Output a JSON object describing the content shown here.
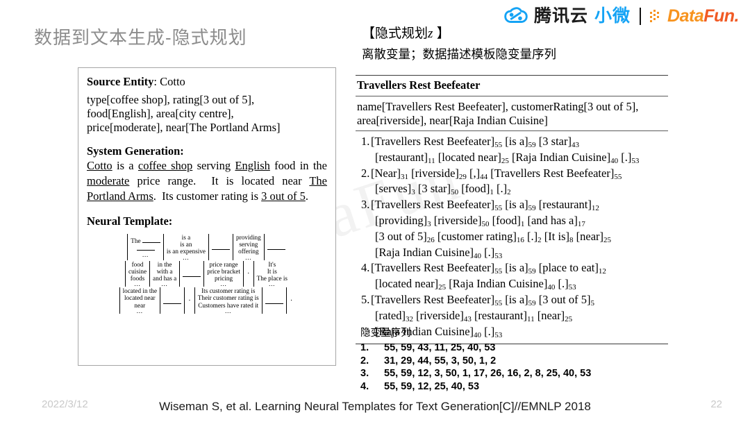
{
  "slide": {
    "title": "数据到文本生成-隐式规划",
    "page_number": "22",
    "date": "2022/3/12",
    "citation": "Wiseman S, et al. Learning Neural Templates for Text Generation[C]//EMNLP 2018",
    "watermark": "DataFun"
  },
  "logo": {
    "tencent_dark": "腾讯云",
    "tencent_blue": "小微",
    "datafun_part1": "Data",
    "datafun_part2": "Fun.",
    "blue": "#14a3f5",
    "orange": "#f7931e",
    "orange2": "#f15a24"
  },
  "left_figure": {
    "source_entity_label": "Source Entity",
    "source_entity_value": ": Cotto",
    "source_lines": [
      "type[coffee shop], rating[3 out of 5],",
      "food[English], area[city centre],",
      "price[moderate], near[The Portland Arms]"
    ],
    "system_generation_label": "System Generation:",
    "system_generation_text": "Cotto is a coffee shop serving English food in the moderate price range.  It is located near The Portland Arms.  Its customer rating is 3 out of 5.",
    "neural_template_label": "Neural Template:",
    "template_rows": [
      {
        "cells": [
          {
            "lines": [
              "The ____",
              "____"
            ],
            "dots": true
          },
          {
            "lines": [
              "is a",
              "is an",
              "is an expensive"
            ],
            "dots": true
          },
          {
            "lines": [
              "____"
            ],
            "dots": false
          },
          {
            "lines": [
              "providing",
              "serving",
              "offering"
            ],
            "dots": true
          },
          {
            "lines": [
              "____"
            ],
            "dots": false
          }
        ]
      },
      {
        "cells": [
          {
            "lines": [
              "food",
              "cuisine",
              "foods"
            ],
            "dots": true
          },
          {
            "lines": [
              "in the",
              "with a",
              "and has a"
            ],
            "dots": true
          },
          {
            "lines": [
              "____"
            ],
            "dots": false
          },
          {
            "lines": [
              "price range",
              "price bracket",
              "pricing"
            ],
            "dots": true
          },
          {
            "lines": [
              "."
            ],
            "dots": false
          },
          {
            "lines": [
              "It's",
              "It is",
              "The place is"
            ],
            "dots": true
          }
        ]
      },
      {
        "cells": [
          {
            "lines": [
              "located in the",
              "located near",
              "near"
            ],
            "dots": true
          },
          {
            "lines": [
              "____"
            ],
            "dots": false
          },
          {
            "lines": [
              "."
            ],
            "dots": false
          },
          {
            "lines": [
              "Its customer rating is",
              "Their customer rating is",
              "Customers have rated it"
            ],
            "dots": true
          },
          {
            "lines": [
              "____"
            ],
            "dots": false
          },
          {
            "lines": [
              "."
            ],
            "dots": false
          }
        ]
      }
    ]
  },
  "right_header": {
    "bracket_title": "【隐式规划z 】",
    "subtitle": "离散变量；数据描述模板隐变量序列"
  },
  "right_panel": {
    "title": "Travellers Rest Beefeater",
    "meta_lines": [
      "name[Travellers Rest Beefeater], customerRating[3 out of 5],",
      "area[riverside], near[Raja Indian Cuisine]"
    ],
    "items": [
      {
        "num": "1.",
        "lines": [
          [
            [
              "[Travellers Rest Beefeater]",
              "55"
            ],
            [
              "[is a]",
              "59"
            ],
            [
              "[3 star]",
              "43"
            ]
          ],
          [
            [
              "[restaurant]",
              "11"
            ],
            [
              "[located near]",
              "25"
            ],
            [
              "[Raja Indian Cuisine]",
              "40"
            ],
            [
              "[.]",
              "53"
            ]
          ]
        ]
      },
      {
        "num": "2.",
        "lines": [
          [
            [
              "[Near]",
              "31"
            ],
            [
              "[riverside]",
              "29"
            ],
            [
              "[,]",
              "44"
            ],
            [
              "[Travellers Rest Beefeater]",
              "55"
            ]
          ],
          [
            [
              "[serves]",
              "3"
            ],
            [
              "[3 star]",
              "50"
            ],
            [
              "[food]",
              "1"
            ],
            [
              "[.]",
              "2"
            ]
          ]
        ]
      },
      {
        "num": "3.",
        "lines": [
          [
            [
              "[Travellers Rest Beefeater]",
              "55"
            ],
            [
              "[is a]",
              "59"
            ],
            [
              "[restaurant]",
              "12"
            ]
          ],
          [
            [
              "[providing]",
              "3"
            ],
            [
              "[riverside]",
              "50"
            ],
            [
              "[food]",
              "1"
            ],
            [
              "[and has a]",
              "17"
            ]
          ],
          [
            [
              "[3 out of 5]",
              "26"
            ],
            [
              "[customer rating]",
              "16"
            ],
            [
              "[.]",
              "2"
            ],
            [
              "[It is]",
              "8"
            ],
            [
              "[near]",
              "25"
            ]
          ],
          [
            [
              "[Raja Indian Cuisine]",
              "40"
            ],
            [
              "[.]",
              "53"
            ]
          ]
        ]
      },
      {
        "num": "4.",
        "lines": [
          [
            [
              "[Travellers Rest Beefeater]",
              "55"
            ],
            [
              "[is a]",
              "59"
            ],
            [
              "[place to eat]",
              "12"
            ]
          ],
          [
            [
              "[located near]",
              "25"
            ],
            [
              "[Raja Indian Cuisine]",
              "40"
            ],
            [
              "[.]",
              "53"
            ]
          ]
        ]
      },
      {
        "num": "5.",
        "lines": [
          [
            [
              "[Travellers Rest Beefeater]",
              "55"
            ],
            [
              "[is a]",
              "59"
            ],
            [
              "[3 out of 5]",
              "5"
            ]
          ],
          [
            [
              "[rated]",
              "32"
            ],
            [
              "[riverside]",
              "43"
            ],
            [
              "[restaurant]",
              "11"
            ],
            [
              "[near]",
              "25"
            ]
          ],
          [
            [
              "[Raja Indian Cuisine]",
              "40"
            ],
            [
              "[.]",
              "53"
            ]
          ]
        ]
      }
    ]
  },
  "latent_sequences": {
    "label": "隐变量序列",
    "rows": [
      {
        "num": "1.",
        "values": "55, 59, 43, 11, 25, 40, 53"
      },
      {
        "num": "2.",
        "values": "31, 29, 44, 55, 3, 50, 1, 2"
      },
      {
        "num": "3.",
        "values": "55, 59, 12, 3, 50, 1, 17, 26, 16, 2, 8, 25, 40, 53"
      },
      {
        "num": "4.",
        "values": "55, 59, 12, 25, 40, 53"
      }
    ]
  }
}
